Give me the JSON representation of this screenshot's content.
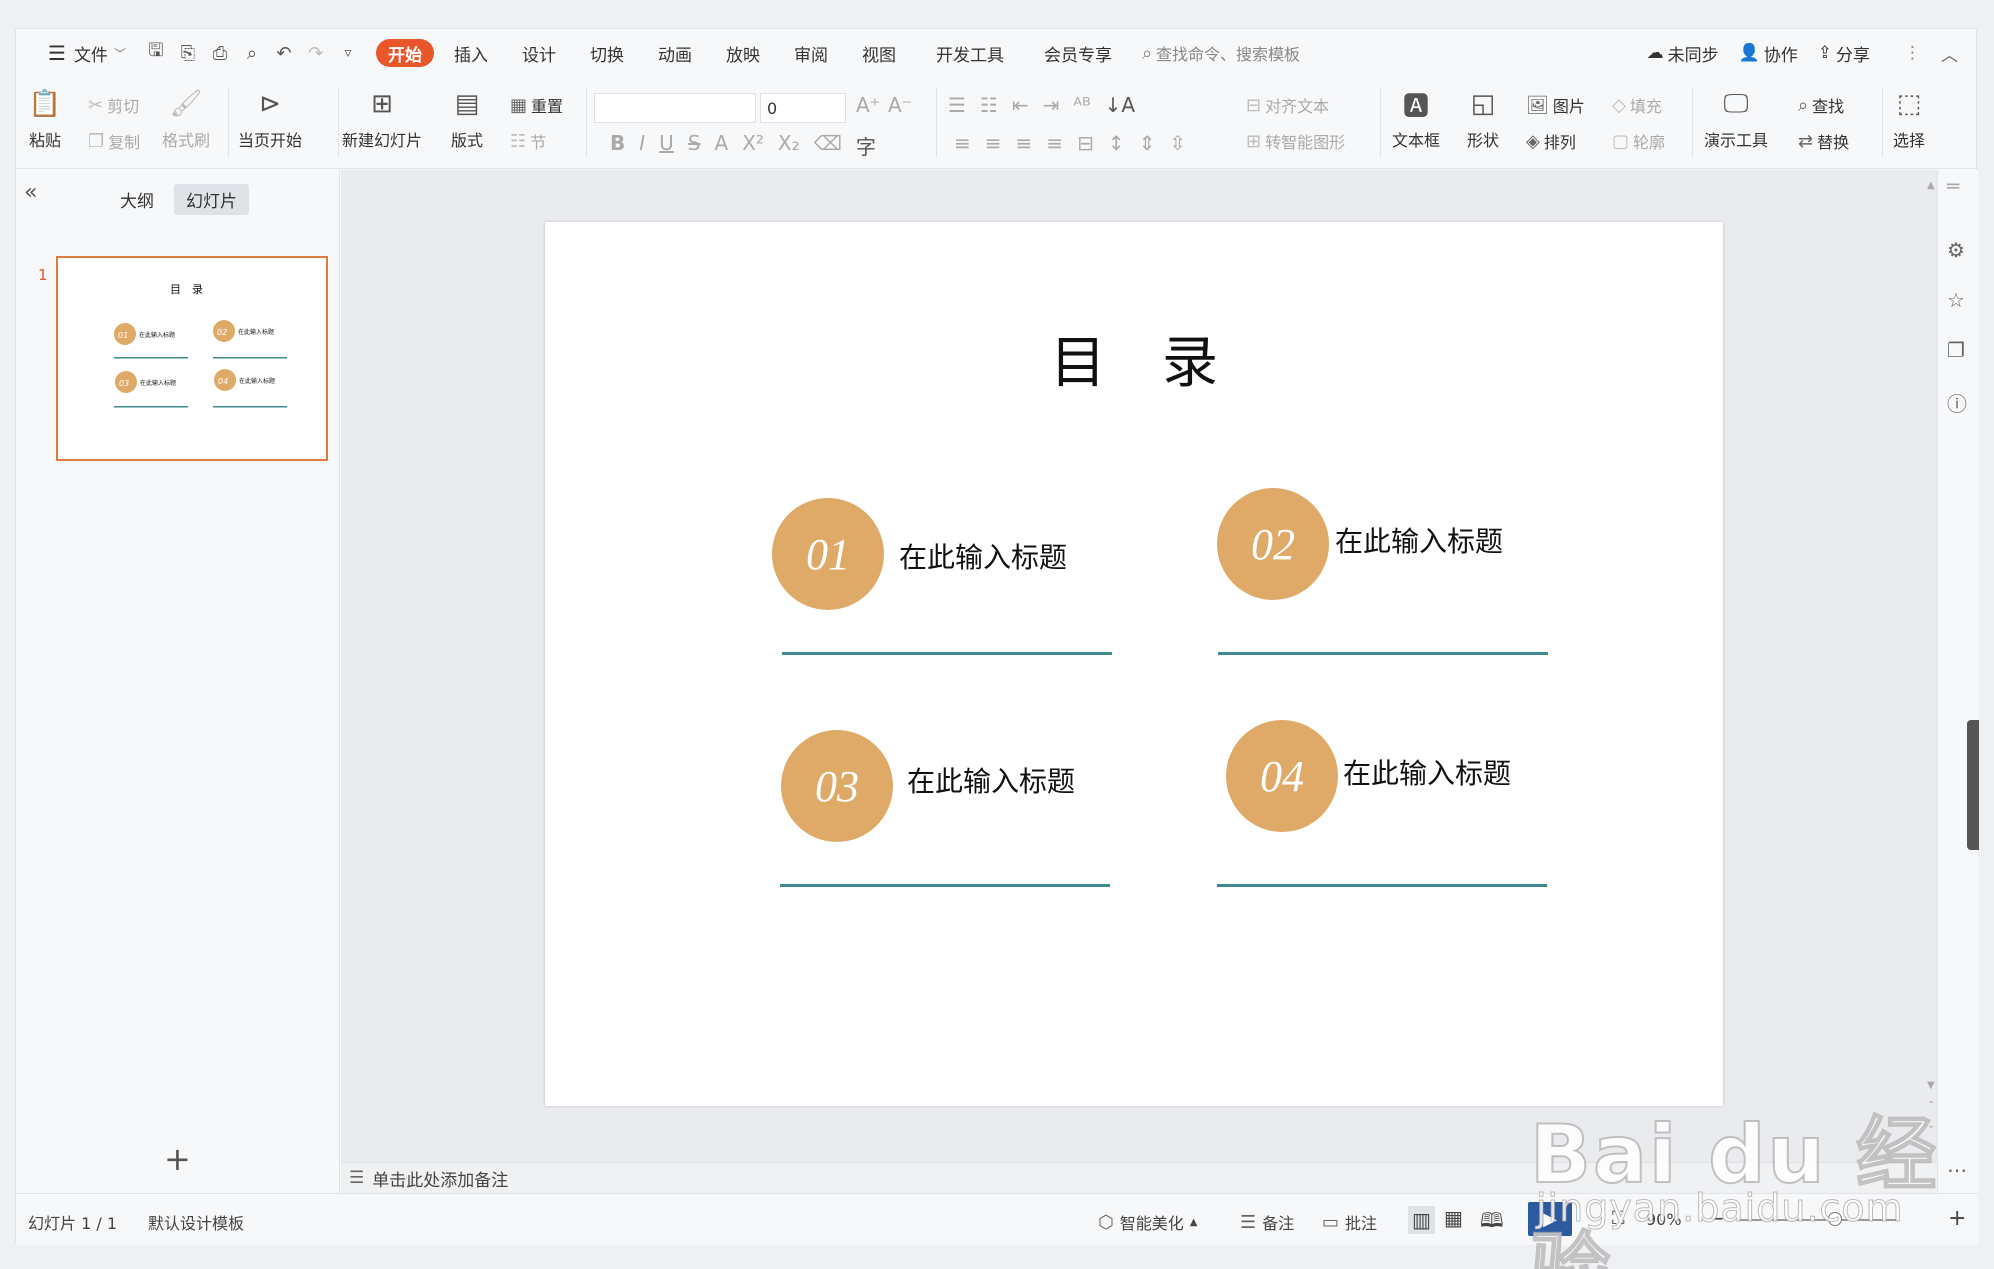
{
  "menubar": {
    "file": "文件",
    "tabs": [
      {
        "label": "开始",
        "active": true
      },
      {
        "label": "插入"
      },
      {
        "label": "设计"
      },
      {
        "label": "切换"
      },
      {
        "label": "动画"
      },
      {
        "label": "放映"
      },
      {
        "label": "审阅"
      },
      {
        "label": "视图"
      },
      {
        "label": "开发工具"
      },
      {
        "label": "会员专享"
      }
    ],
    "search_placeholder": "查找命令、搜索模板",
    "sync": "未同步",
    "collab": "协作",
    "share": "分享"
  },
  "ribbon": {
    "paste": "粘贴",
    "cut": "剪切",
    "copy": "复制",
    "format_painter": "格式刷",
    "play_from_current": "当页开始",
    "new_slide": "新建幻灯片",
    "layout": "版式",
    "reset": "重置",
    "section": "节",
    "font_size": "0",
    "align_text": "对齐文本",
    "smartart": "转智能图形",
    "textbox": "文本框",
    "shape": "形状",
    "picture": "图片",
    "fill": "填充",
    "arrange": "排列",
    "outline": "轮廓",
    "presentation_tools": "演示工具",
    "find": "查找",
    "replace": "替换",
    "select": "选择"
  },
  "left_panel": {
    "tab_outline": "大纲",
    "tab_slides": "幻灯片",
    "slide_number": "1"
  },
  "slide": {
    "title": "目　录",
    "items": [
      {
        "num": "01",
        "label": "在此输入标题"
      },
      {
        "num": "02",
        "label": "在此输入标题"
      },
      {
        "num": "03",
        "label": "在此输入标题"
      },
      {
        "num": "04",
        "label": "在此输入标题"
      }
    ],
    "circle_color": "#dfaa67",
    "line_color": "#3d8b8d"
  },
  "notes": {
    "placeholder": "单击此处添加备注"
  },
  "statusbar": {
    "slide_count": "幻灯片 1 / 1",
    "template": "默认设计模板",
    "beautify": "智能美化",
    "notes": "备注",
    "comments": "批注",
    "zoom": "90%"
  },
  "watermark": {
    "brand": "Bai du 经验",
    "url": "jingyan.baidu.com"
  },
  "colors": {
    "accent": "#e8562a",
    "thumb_border": "#e07b40"
  }
}
